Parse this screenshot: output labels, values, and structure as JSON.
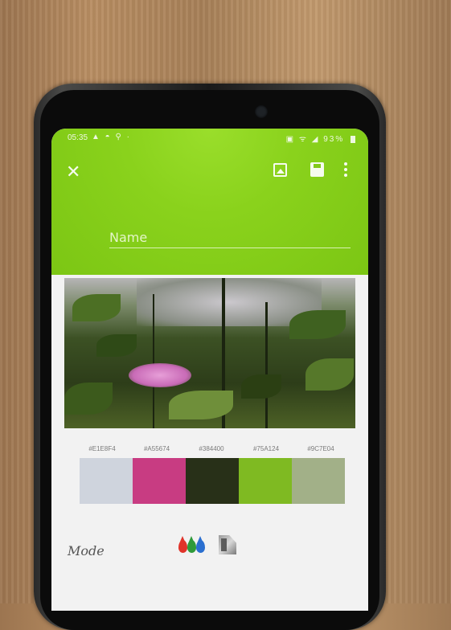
{
  "status_bar": {
    "time": "05:35",
    "left_icons": "▲ ◓ ⚲ ·",
    "right_icons": "▣ ᯤ ◢",
    "battery": "93%"
  },
  "toolbar": {
    "close_icon": "close-icon",
    "image_icon": "image-icon",
    "save_icon": "save-icon",
    "more_icon": "more-vert-icon"
  },
  "name_field": {
    "placeholder": "Name",
    "value": ""
  },
  "palette": {
    "hex_labels": [
      "#E1E8F4",
      "#A55674",
      "#384400",
      "#75A124",
      "#9C7E04"
    ],
    "colors": [
      "#cfd4dd",
      "#c83c82",
      "#283018",
      "#7fba22",
      "#a2b088"
    ]
  },
  "mode": {
    "label": "Mode",
    "options": [
      "color-drops-icon",
      "grayscale-icon"
    ],
    "drop_colors": [
      "#e0342a",
      "#2f9a3a",
      "#2a6fd0"
    ]
  },
  "colors": {
    "accent": "#8ad21c"
  }
}
